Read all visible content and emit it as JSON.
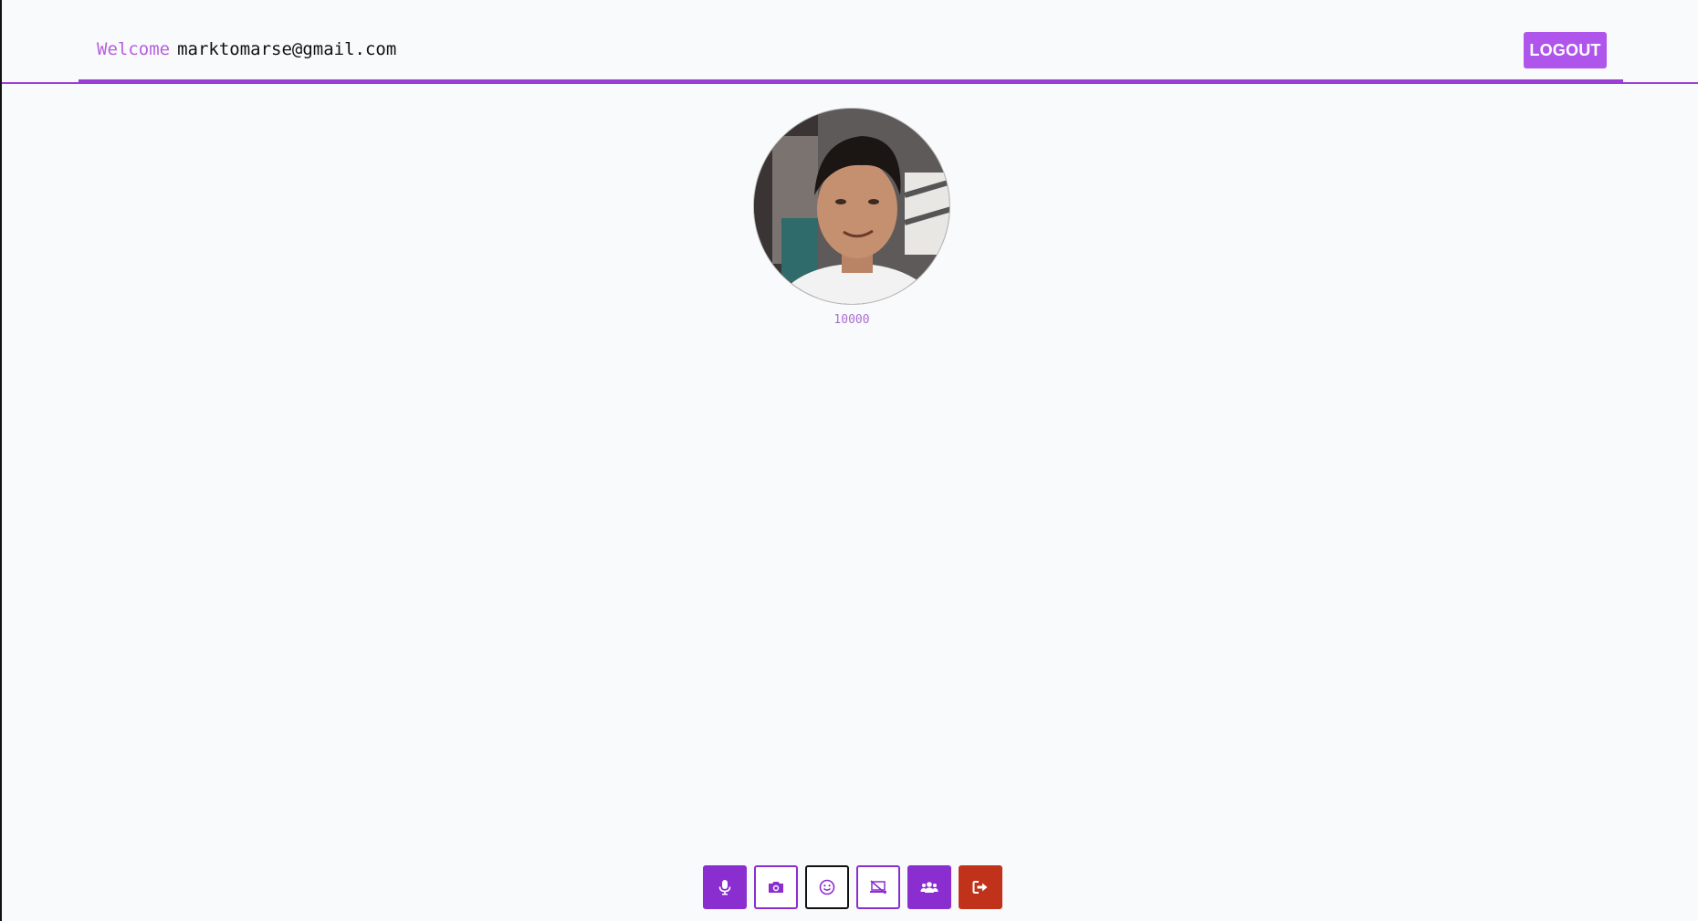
{
  "header": {
    "welcome_label": "Welcome",
    "user_email": "marktomarse@gmail.com",
    "logout_label": "LOGOUT"
  },
  "participant": {
    "id_label": "10000"
  },
  "controls": [
    {
      "name": "microphone-button",
      "icon": "microphone-icon"
    },
    {
      "name": "camera-button",
      "icon": "camera-icon"
    },
    {
      "name": "emoji-button",
      "icon": "smile-icon"
    },
    {
      "name": "screen-share-off-button",
      "icon": "screen-share-off-icon"
    },
    {
      "name": "participants-button",
      "icon": "users-icon"
    },
    {
      "name": "leave-button",
      "icon": "sign-out-icon"
    }
  ],
  "colors": {
    "accent": "#9b3ed8",
    "button_primary": "#8a2ed0",
    "logout": "#b055ec",
    "leave": "#c0331a",
    "welcome_text": "#b75fe0",
    "id_text": "#a86fd0"
  }
}
